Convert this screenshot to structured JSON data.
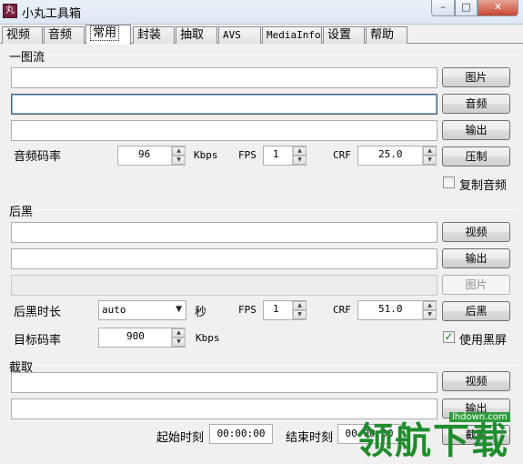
{
  "window": {
    "title": "小丸工具箱",
    "icon_text": "丸",
    "minimize_glyph": "–",
    "maximize_glyph": "□",
    "close_glyph": "✕"
  },
  "tabs": [
    "视频",
    "音频",
    "常用",
    "封装",
    "抽取",
    "AVS",
    "MediaInfo",
    "设置",
    "帮助"
  ],
  "active_tab": "常用",
  "section_onepic": {
    "title": "一图流",
    "btn_picture": "图片",
    "btn_audio": "音频",
    "btn_output": "输出",
    "btn_encode": "压制",
    "audio_bitrate_label": "音频码率",
    "audio_bitrate_value": "96",
    "audio_bitrate_unit": "Kbps",
    "fps_label": "FPS",
    "fps_value": "1",
    "crf_label": "CRF",
    "crf_value": "25.0",
    "copy_audio_label": "复制音频",
    "copy_audio_checked": false
  },
  "section_black": {
    "title": "后黑",
    "btn_video": "视频",
    "btn_output": "输出",
    "btn_picture": "图片",
    "btn_run": "后黑",
    "duration_label": "后黑时长",
    "duration_value": "auto",
    "duration_unit": "秒",
    "fps_label": "FPS",
    "fps_value": "1",
    "crf_label": "CRF",
    "crf_value": "51.0",
    "target_bitrate_label": "目标码率",
    "target_bitrate_value": "900",
    "target_bitrate_unit": "Kbps",
    "use_black_label": "使用黑屏",
    "use_black_checked": true,
    "check_glyph": "✓"
  },
  "section_clip": {
    "title": "截取",
    "btn_video": "视频",
    "btn_output": "输出",
    "btn_clip": "截取",
    "start_label": "起始时刻",
    "start_value": "00:00:00",
    "end_label": "结束时刻",
    "end_value": "00:00:00"
  },
  "watermark": {
    "text": "领航下载",
    "site": "lhdown.com"
  }
}
